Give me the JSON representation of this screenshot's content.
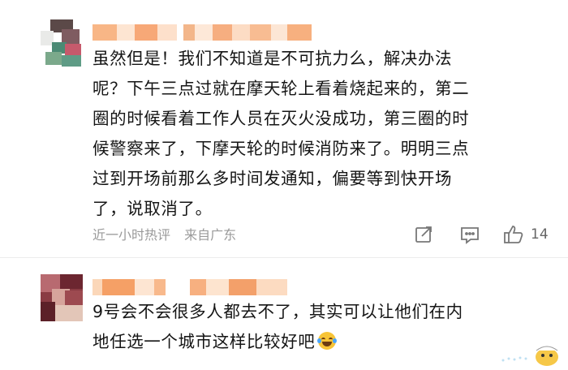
{
  "comments": [
    {
      "text": "虽然但是！我们不知道是不可抗力么，解决办法\n呢？下午三点过就在摩天轮上看着烧起来的，第二\n圈的时候看着工作人员在灭火没成功，第三圈的时\n候警察来了，下摩天轮的时候消防来了。明明三点\n过到开场前那么多时间发通知，偏要等到快开场\n了，说取消了。",
      "meta": {
        "time": "近一小时热评",
        "location": "来自广东"
      },
      "actions": {
        "share_icon": "share-icon",
        "reply_icon": "comment-icon",
        "like_icon": "thumbs-up-icon",
        "like_count": "14"
      }
    },
    {
      "text": "9号会不会很多人都去不了，其实可以让他们在内\n地任选一个城市这样比较好吧",
      "emoji": "laugh-cry-emoji"
    }
  ],
  "colors": {
    "text": "#151515",
    "meta": "#9a9a9a",
    "divider": "#ececec",
    "blur_orange": "#f7b27a"
  }
}
